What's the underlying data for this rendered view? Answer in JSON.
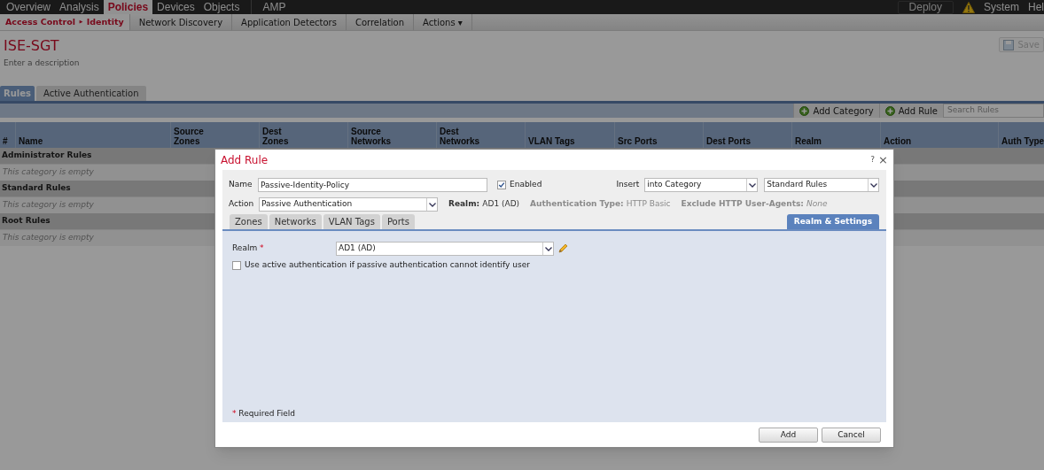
{
  "top_nav": {
    "items": [
      {
        "label": "Overview",
        "selected": false
      },
      {
        "label": "Analysis",
        "selected": false
      },
      {
        "label": "Policies",
        "selected": true
      },
      {
        "label": "Devices",
        "selected": false
      },
      {
        "label": "Objects",
        "selected": false
      },
      {
        "label": "AMP",
        "selected": false
      }
    ],
    "deploy": "Deploy",
    "system": "System",
    "help": "Hel"
  },
  "sub_nav": [
    {
      "label": "Access Control ‣ Identity",
      "selected": true
    },
    {
      "label": "Network Discovery",
      "selected": false
    },
    {
      "label": "Application Detectors",
      "selected": false
    },
    {
      "label": "Correlation",
      "selected": false
    },
    {
      "label": "Actions ▾",
      "selected": false
    }
  ],
  "policy": {
    "title": "ISE-SGT",
    "description_placeholder": "Enter a description",
    "save": "Save"
  },
  "tabs": [
    {
      "label": "Rules",
      "selected": true
    },
    {
      "label": "Active Authentication",
      "selected": false
    }
  ],
  "toolbar": {
    "add_category": "Add Category",
    "add_rule": "Add Rule",
    "search_placeholder": "Search Rules"
  },
  "table": {
    "columns": [
      {
        "label": "#"
      },
      {
        "label": "Name"
      },
      {
        "label": "Source Zones"
      },
      {
        "label": "Dest Zones"
      },
      {
        "label": "Source Networks"
      },
      {
        "label": "Dest Networks"
      },
      {
        "label": "VLAN Tags"
      },
      {
        "label": "Src Ports"
      },
      {
        "label": "Dest Ports"
      },
      {
        "label": "Realm"
      },
      {
        "label": "Action"
      },
      {
        "label": "Auth Type"
      }
    ],
    "categories": [
      {
        "name": "Administrator Rules",
        "empty_text": "This category is empty"
      },
      {
        "name": "Standard Rules",
        "empty_text": "This category is empty"
      },
      {
        "name": "Root Rules",
        "empty_text": "This category is empty"
      }
    ]
  },
  "dialog": {
    "title": "Add Rule",
    "help": "?",
    "close": "×",
    "name": {
      "label": "Name",
      "value": "Passive-Identity-Policy"
    },
    "enabled": {
      "label": "Enabled",
      "checked": true
    },
    "insert": {
      "label": "Insert",
      "position": "into Category",
      "category": "Standard Rules"
    },
    "action": {
      "label": "Action",
      "value": "Passive Authentication"
    },
    "summary": [
      {
        "label": "Realm:",
        "value": "AD1 (AD)",
        "muted": false
      },
      {
        "label": "Authentication Type:",
        "value": "HTTP Basic",
        "muted": true
      },
      {
        "label": "Exclude HTTP User-Agents:",
        "value": "None",
        "muted": true
      }
    ],
    "tabs": [
      {
        "label": "Zones",
        "selected": false
      },
      {
        "label": "Networks",
        "selected": false
      },
      {
        "label": "VLAN Tags",
        "selected": false
      },
      {
        "label": "Ports",
        "selected": false
      },
      {
        "label": "Realm & Settings",
        "selected": true
      }
    ],
    "realm": {
      "label": "Realm",
      "required_mark": "*",
      "value": "AD1 (AD)"
    },
    "active_auth": {
      "label": "Use active authentication if passive authentication cannot identify user",
      "checked": false
    },
    "required_note": {
      "mark": "*",
      "text": "Required Field"
    },
    "buttons": [
      "Add",
      "Cancel"
    ]
  }
}
